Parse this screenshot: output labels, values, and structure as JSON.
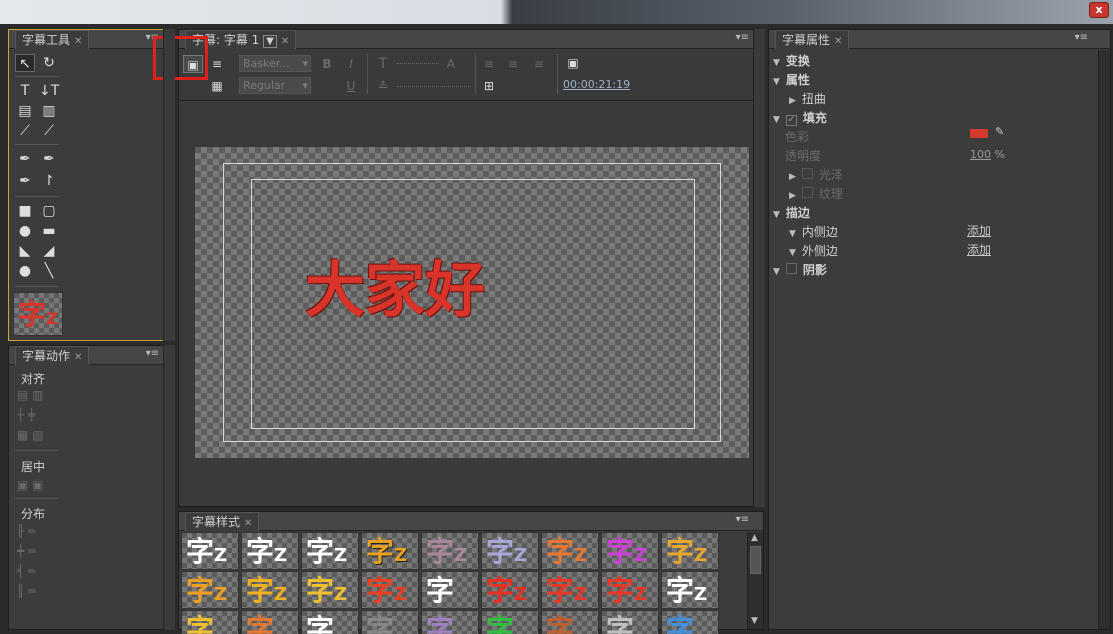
{
  "window": {
    "close_glyph": "x"
  },
  "tools_panel": {
    "title": "字幕工具",
    "preview_text": "字",
    "preview_z": "Z"
  },
  "actions_panel": {
    "title": "字幕动作",
    "align_label": "对齐",
    "center_label": "居中",
    "distribute_label": "分布"
  },
  "editor_panel": {
    "tab_title": "字幕: 字幕 1",
    "font_family": "Basker...",
    "font_style": "Regular",
    "bold": "B",
    "italic": "I",
    "underline": "U",
    "timecode": "00:00:21:19",
    "canvas_text": "大家好"
  },
  "styles_panel": {
    "title": "字幕样式",
    "rows": [
      [
        "字",
        "字",
        "字",
        "字",
        "字",
        "字",
        "字",
        "字",
        "字"
      ],
      [
        "字",
        "字",
        "字",
        "字",
        "字",
        "字",
        "字",
        "字",
        "字"
      ],
      [
        "字",
        "字",
        "字",
        "字",
        "字",
        "字",
        "字",
        "字",
        "字"
      ]
    ]
  },
  "properties_panel": {
    "title": "字幕属性",
    "transform": "变换",
    "properties": "属性",
    "distort": "扭曲",
    "fill": "填充",
    "color_label": "色彩",
    "opacity_label": "透明度",
    "opacity_value": "100",
    "opacity_unit": "%",
    "sheen": "光泽",
    "texture": "纹理",
    "stroke": "描边",
    "inner_stroke": "内侧边",
    "outer_stroke": "外侧边",
    "add_label": "添加",
    "shadow": "阴影",
    "fill_color": "#d33a2c"
  },
  "colors": {
    "highlight_box": "#e0201a",
    "text_red": "#d8342a",
    "panel_border_active": "#c8a23a"
  }
}
